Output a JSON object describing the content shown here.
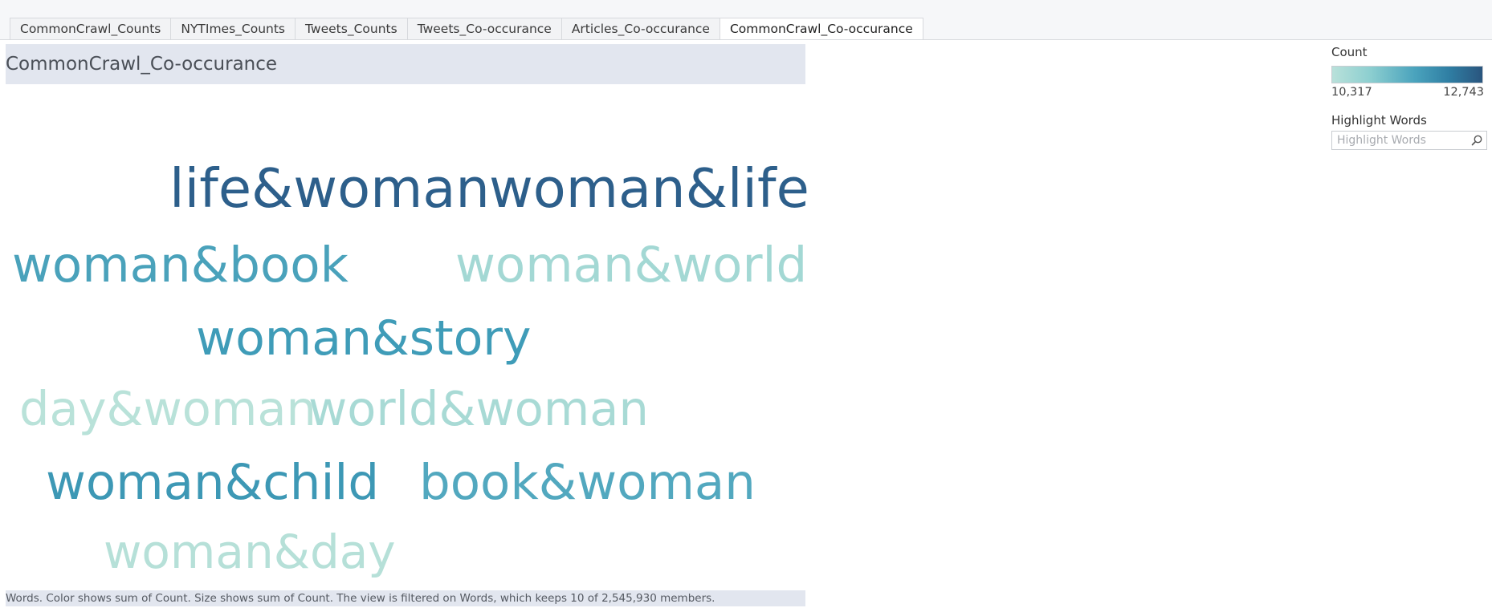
{
  "tabs": [
    {
      "label": "CommonCrawl_Counts",
      "active": false
    },
    {
      "label": "NYTImes_Counts",
      "active": false
    },
    {
      "label": "Tweets_Counts",
      "active": false
    },
    {
      "label": "Tweets_Co-occurance",
      "active": false
    },
    {
      "label": "Articles_Co-occurance",
      "active": false
    },
    {
      "label": "CommonCrawl_Co-occurance",
      "active": true
    }
  ],
  "sheet_title": "CommonCrawl_Co-occurance",
  "words": [
    {
      "text": "life&woman",
      "color": "#2d5f8b"
    },
    {
      "text": "woman&life",
      "color": "#2d5f8b"
    },
    {
      "text": "woman&book",
      "color": "#4aa2bb"
    },
    {
      "text": "woman&world",
      "color": "#a3d8d4"
    },
    {
      "text": "woman&story",
      "color": "#3f9cb8"
    },
    {
      "text": "day&woman",
      "color": "#b9e2d9"
    },
    {
      "text": "world&woman",
      "color": "#a8dad5"
    },
    {
      "text": "woman&child",
      "color": "#3d98b5"
    },
    {
      "text": "book&woman",
      "color": "#52a8bf"
    },
    {
      "text": "woman&day",
      "color": "#b6e0d8"
    }
  ],
  "caption": "Words.  Color shows sum of Count.  Size shows sum of Count. The view is filtered on Words, which keeps 10 of 2,545,930 members.",
  "legend": {
    "title": "Count",
    "min_label": "10,317",
    "max_label": "12,743"
  },
  "highlight": {
    "title": "Highlight Words",
    "placeholder": "Highlight Words",
    "icon": "search-icon"
  }
}
